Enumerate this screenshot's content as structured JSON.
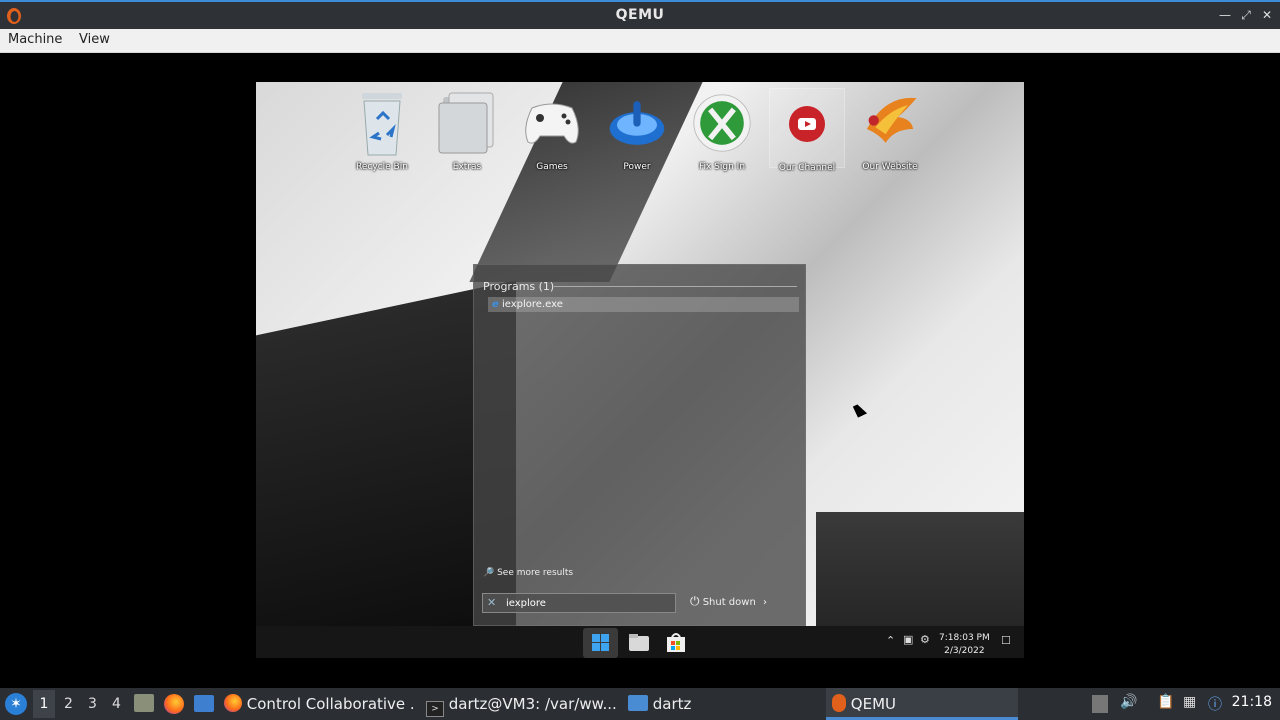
{
  "window": {
    "title": "QEMU",
    "app_icon": "qemu-icon"
  },
  "menubar": {
    "items": [
      "Machine",
      "View"
    ]
  },
  "desktop_icons": [
    {
      "label": "Recycle Bin",
      "icon": "recycle-bin-icon"
    },
    {
      "label": "Extras",
      "icon": "folder-icon"
    },
    {
      "label": "Games",
      "icon": "gamepad-icon"
    },
    {
      "label": "Power",
      "icon": "power-icon"
    },
    {
      "label": "Fix Sign In",
      "icon": "xbox-icon"
    },
    {
      "label": "Our Channel",
      "icon": "youtube-icon"
    },
    {
      "label": "Our Website",
      "icon": "phoenix-icon"
    }
  ],
  "start_menu": {
    "category": "Programs (1)",
    "results": [
      {
        "label": "iexplore.exe",
        "icon": "internet-explorer-icon"
      }
    ],
    "see_more": "See more results",
    "search_value": "iexplore",
    "shutdown_label": "Shut down"
  },
  "vm_taskbar": {
    "time": "7:18:03 PM",
    "date": "2/3/2022"
  },
  "host_taskbar": {
    "workspaces": [
      "1",
      "2",
      "3",
      "4"
    ],
    "tasks": [
      {
        "label": "Control Collaborative ..."
      },
      {
        "label": "dartz@VM3: /var/ww..."
      },
      {
        "label": "dartz"
      },
      {
        "label": "QEMU"
      }
    ],
    "clock": "21:18"
  },
  "colors": {
    "accent": "#4a8cd4",
    "titlebar": "#2e3136",
    "hostbar": "#2b2e33"
  }
}
